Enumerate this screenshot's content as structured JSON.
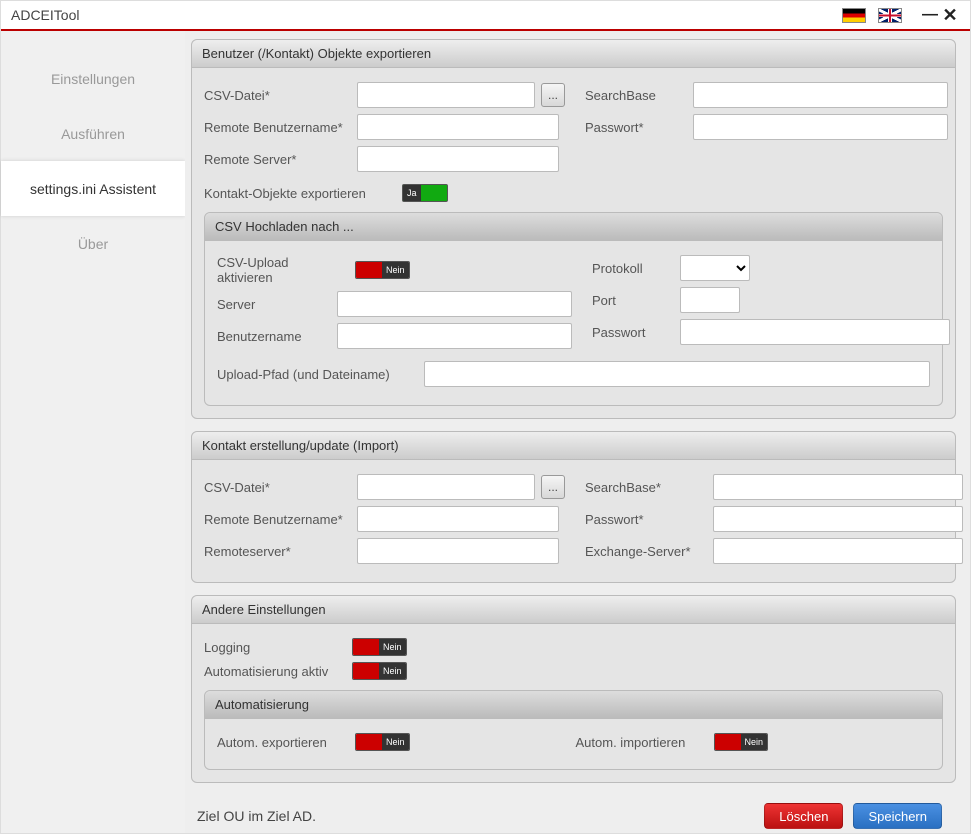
{
  "window": {
    "title": "ADCEITool"
  },
  "sidebar": {
    "items": [
      {
        "label": "Einstellungen"
      },
      {
        "label": "Ausführen"
      },
      {
        "label": "settings.ini Assistent"
      },
      {
        "label": "Über"
      }
    ],
    "active_index": 2
  },
  "export_panel": {
    "title": "Benutzer (/Kontakt) Objekte exportieren",
    "csv_file_label": "CSV-Datei*",
    "csv_file_value": "",
    "browse_label": "...",
    "remote_user_label": "Remote Benutzername*",
    "remote_user_value": "",
    "remote_server_label": "Remote Server*",
    "remote_server_value": "",
    "searchbase_label": "SearchBase",
    "searchbase_value": "",
    "password_label": "Passwort*",
    "password_value": "",
    "contact_export_label": "Kontakt-Objekte exportieren",
    "contact_export_toggle": "Ja",
    "upload_panel": {
      "title": "CSV Hochladen nach ...",
      "activate_label": "CSV-Upload aktivieren",
      "activate_toggle": "Nein",
      "protocol_label": "Protokoll",
      "protocol_value": "",
      "server_label": "Server",
      "server_value": "",
      "port_label": "Port",
      "port_value": "",
      "user_label": "Benutzername",
      "user_value": "",
      "password_label": "Passwort",
      "password_value": "",
      "path_label": "Upload-Pfad (und Dateiname)",
      "path_value": ""
    }
  },
  "import_panel": {
    "title": "Kontakt erstellung/update (Import)",
    "csv_file_label": "CSV-Datei*",
    "csv_file_value": "",
    "browse_label": "...",
    "remote_user_label": "Remote Benutzername*",
    "remote_user_value": "",
    "remote_server_label": "Remoteserver*",
    "remote_server_value": "",
    "searchbase_label": "SearchBase*",
    "searchbase_value": "",
    "password_label": "Passwort*",
    "password_value": "",
    "exchange_label": "Exchange-Server*",
    "exchange_value": ""
  },
  "other_panel": {
    "title": "Andere Einstellungen",
    "logging_label": "Logging",
    "logging_toggle": "Nein",
    "auto_active_label": "Automatisierung aktiv",
    "auto_active_toggle": "Nein",
    "auto_panel": {
      "title": "Automatisierung",
      "auto_export_label": "Autom. exportieren",
      "auto_export_toggle": "Nein",
      "auto_import_label": "Autom. importieren",
      "auto_import_toggle": "Nein"
    }
  },
  "footer": {
    "status": "Ziel OU im Ziel AD.",
    "delete_label": "Löschen",
    "save_label": "Speichern"
  }
}
